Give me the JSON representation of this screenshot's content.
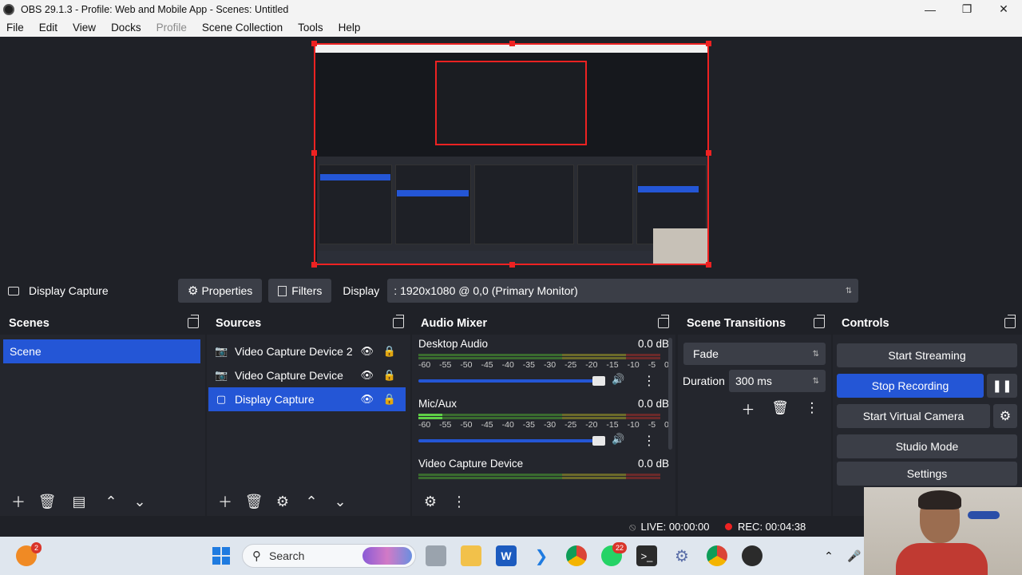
{
  "window": {
    "title": "OBS 29.1.3 - Profile: Web and Mobile App - Scenes: Untitled",
    "controls": [
      "minimize",
      "restore",
      "close"
    ]
  },
  "menu": {
    "items": [
      "File",
      "Edit",
      "View",
      "Docks",
      "Profile",
      "Scene Collection",
      "Tools",
      "Help"
    ],
    "disabled": [
      "Profile"
    ]
  },
  "source_toolbar": {
    "source_name": "Display Capture",
    "properties_label": "Properties",
    "filters_label": "Filters",
    "display_label": "Display",
    "display_value": ": 1920x1080 @ 0,0 (Primary Monitor)"
  },
  "scenes": {
    "title": "Scenes",
    "items": [
      "Scene"
    ],
    "selected": "Scene"
  },
  "sources": {
    "title": "Sources",
    "items": [
      "Video Capture Device 2",
      "Video Capture Device",
      "Display Capture"
    ],
    "selected": "Display Capture"
  },
  "audio_mixer": {
    "title": "Audio Mixer",
    "scale": [
      "-60",
      "-55",
      "-50",
      "-45",
      "-40",
      "-35",
      "-30",
      "-25",
      "-20",
      "-15",
      "-10",
      "-5",
      "0"
    ],
    "channels": [
      {
        "name": "Desktop Audio",
        "level": "0.0 dB"
      },
      {
        "name": "Mic/Aux",
        "level": "0.0 dB"
      },
      {
        "name": "Video Capture Device",
        "level": "0.0 dB"
      }
    ]
  },
  "scene_transitions": {
    "title": "Scene Transitions",
    "transition": "Fade",
    "duration_label": "Duration",
    "duration_value": "300 ms"
  },
  "controls": {
    "title": "Controls",
    "start_streaming": "Start Streaming",
    "stop_recording": "Stop Recording",
    "start_virtual_camera": "Start Virtual Camera",
    "studio_mode": "Studio Mode",
    "settings": "Settings"
  },
  "status": {
    "live": "LIVE: 00:00:00",
    "rec": "REC: 00:04:38"
  },
  "taskbar": {
    "search_placeholder": "Search",
    "weather_badge": "2",
    "whatsapp_badge": "22",
    "apps": [
      "weather-icon",
      "windows-start-icon",
      "search-icon",
      "task-view-icon",
      "file-explorer-icon",
      "word-icon",
      "vscode-icon",
      "chrome-icon",
      "whatsapp-icon",
      "terminal-icon",
      "settings-app-icon",
      "chrome-profile-icon",
      "obs-icon"
    ]
  },
  "colors": {
    "accent": "#2456d6",
    "recording": "#e22222",
    "panel_bg": "#24262d",
    "window_bg": "#1f2127"
  }
}
